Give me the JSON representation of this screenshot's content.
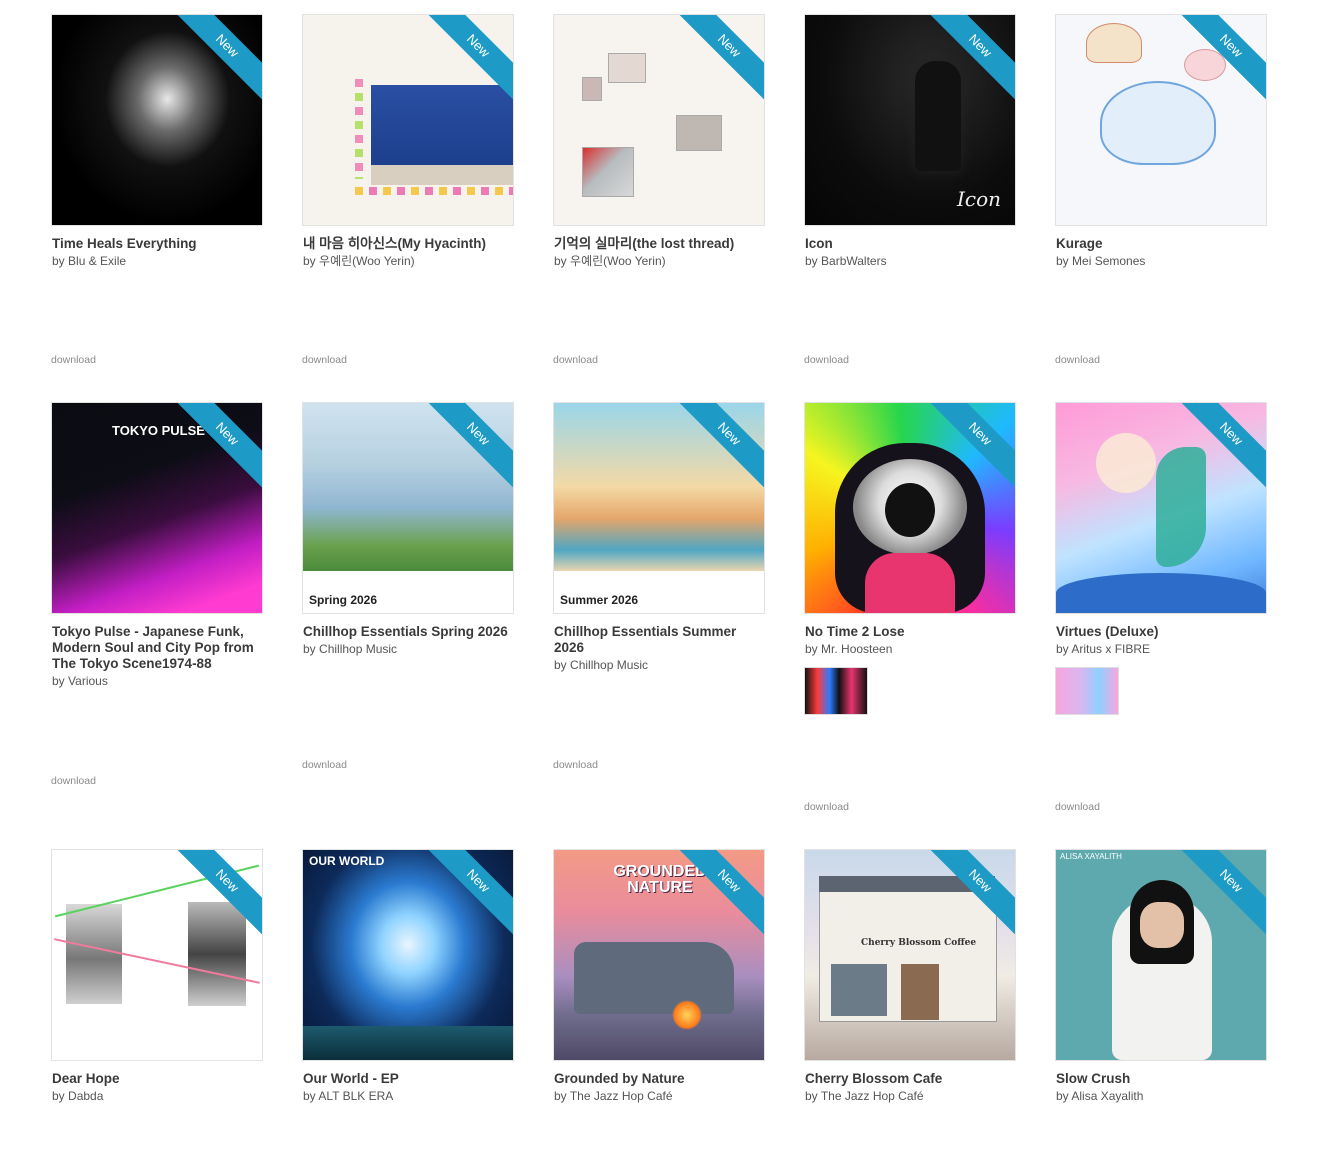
{
  "ribbon_label": "New",
  "download_label": "download",
  "artist_prefix": "by",
  "accent_color": "#1d9bc6",
  "albums": [
    {
      "title": "Time Heals Everything",
      "artist": "Blu & Exile"
    },
    {
      "title": "내 마음 히아신스(My Hyacinth)",
      "artist": "우예린(Woo Yerin)"
    },
    {
      "title": "기억의 실마리(the lost thread)",
      "artist": "우예린(Woo Yerin)"
    },
    {
      "title": "Icon",
      "artist": "BarbWalters",
      "art_text": "Icon"
    },
    {
      "title": "Kurage",
      "artist": "Mei Semones"
    },
    {
      "title": "Tokyo Pulse - Japanese Funk, Modern Soul and City Pop from The Tokyo Scene1974-88",
      "artist": "Various",
      "art_text": "TOKYO PULSE"
    },
    {
      "title": "Chillhop Essentials Spring 2026",
      "artist": "Chillhop Music",
      "art_text": "Spring 2026"
    },
    {
      "title": "Chillhop Essentials Summer 2026",
      "artist": "Chillhop Music",
      "art_text": "Summer 2026"
    },
    {
      "title": "No Time 2 Lose",
      "artist": "Mr. Hoosteen"
    },
    {
      "title": "Virtues (Deluxe)",
      "artist": "Aritus x FIBRE"
    },
    {
      "title": "Dear Hope",
      "artist": "Dabda"
    },
    {
      "title": "Our World - EP",
      "artist": "ALT BLK ERA",
      "art_text": "OUR WORLD"
    },
    {
      "title": "Grounded by Nature",
      "artist": "The Jazz Hop Café",
      "art_text": "GROUNDED NATURE"
    },
    {
      "title": "Cherry Blossom Cafe",
      "artist": "The Jazz Hop Café",
      "art_text": "Cherry Blossom Coffee"
    },
    {
      "title": "Slow Crush",
      "artist": "Alisa Xayalith",
      "art_text": "ALISA XAYALITH"
    }
  ]
}
